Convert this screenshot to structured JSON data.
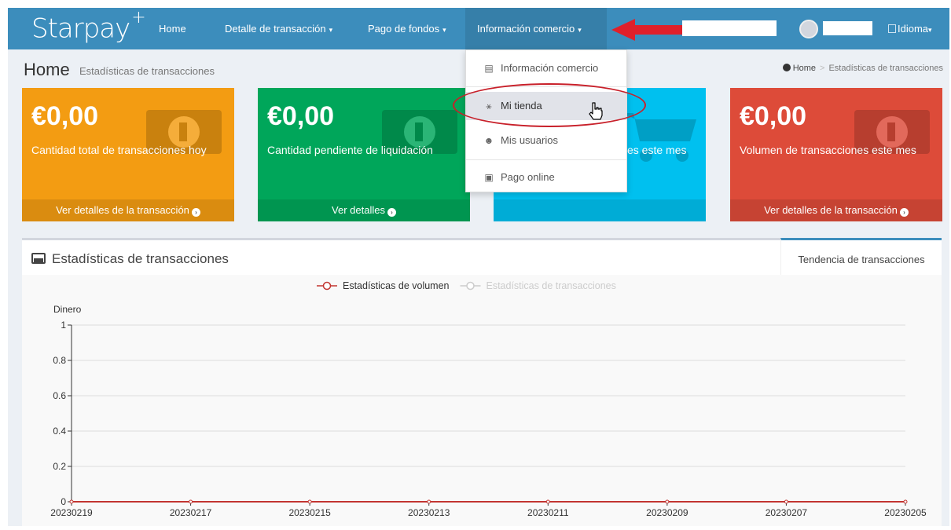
{
  "app": {
    "logo": "Starpay",
    "logo_sup": "+"
  },
  "nav": {
    "items": [
      {
        "label": "Home"
      },
      {
        "label": "Detalle de transacción",
        "caret": "▾"
      },
      {
        "label": "Pago de fondos",
        "caret": "▾"
      },
      {
        "label": "Información comercio",
        "caret": "▾"
      }
    ],
    "language_label": "Idioma",
    "language_caret": "▾"
  },
  "dropdown": {
    "items": [
      {
        "label": "Información comercio",
        "icon": "id-card-icon"
      },
      {
        "label": "Mi tienda",
        "icon": "sitemap-icon"
      },
      {
        "label": "Mis usuarios",
        "icon": "users-icon"
      },
      {
        "label": "Pago online",
        "icon": "money-icon"
      }
    ]
  },
  "header": {
    "title": "Home",
    "subtitle": "Estadísticas de transacciones",
    "breadcrumb": [
      "Home",
      "Estadísticas de transacciones"
    ],
    "breadcrumb_sep": ">"
  },
  "stats": [
    {
      "value": "€0,00",
      "label": "Cantidad total de transacciones hoy",
      "link": "Ver detalles de la transacción",
      "color": "#f39c12",
      "icon": "money-icon"
    },
    {
      "value": "€0,00",
      "label": "Cantidad pendiente de liquidación",
      "link": "Ver detalles",
      "color": "#00a65a",
      "icon": "money-icon"
    },
    {
      "value": "",
      "label": "es este mes",
      "link": "",
      "color": "#00c0ef",
      "icon": "shopping-cart-icon"
    },
    {
      "value": "€0,00",
      "label": "Volumen de transacciones este mes",
      "link": "Ver detalles de la transacción",
      "color": "#dd4b39",
      "icon": "money-icon"
    }
  ],
  "panel": {
    "title": "Estadísticas de transacciones",
    "tab": "Tendencia de transacciones"
  },
  "chart_data": {
    "type": "line",
    "ylabel": "Dinero",
    "ylim": [
      0,
      1
    ],
    "y_ticks": [
      "0",
      "0.2",
      "0.4",
      "0.6",
      "0.8",
      "1"
    ],
    "x": [
      "20230219",
      "20230217",
      "20230215",
      "20230213",
      "20230211",
      "20230209",
      "20230207",
      "20230205"
    ],
    "legend_position": "top-center",
    "series": [
      {
        "name": "Estadísticas de volumen",
        "values": [
          0,
          0,
          0,
          0,
          0,
          0,
          0,
          0
        ],
        "color": "#c23531",
        "active": true
      },
      {
        "name": "Estadísticas de transacciones",
        "values": [
          0,
          0,
          0,
          0,
          0,
          0,
          0,
          0
        ],
        "color": "#cccccc",
        "active": false
      }
    ]
  }
}
